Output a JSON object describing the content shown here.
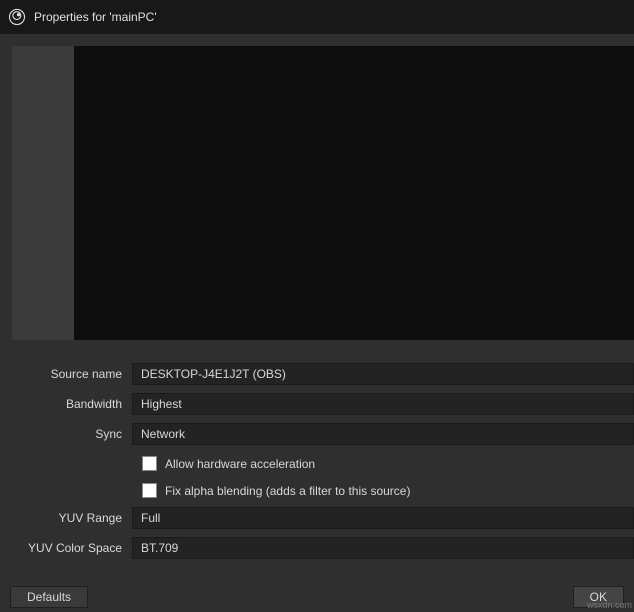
{
  "window": {
    "title": "Properties for 'mainPC'"
  },
  "form": {
    "source_name": {
      "label": "Source name",
      "value": "DESKTOP-J4E1J2T (OBS)"
    },
    "bandwidth": {
      "label": "Bandwidth",
      "value": "Highest"
    },
    "sync": {
      "label": "Sync",
      "value": "Network"
    },
    "hw_accel": {
      "label": "Allow hardware acceleration",
      "checked": false
    },
    "alpha_blend": {
      "label": "Fix alpha blending (adds a filter to this source)",
      "checked": false
    },
    "yuv_range": {
      "label": "YUV Range",
      "value": "Full"
    },
    "yuv_cs": {
      "label": "YUV Color Space",
      "value": "BT.709"
    }
  },
  "footer": {
    "defaults": "Defaults",
    "ok": "OK"
  },
  "watermark": "wsxdn.com"
}
